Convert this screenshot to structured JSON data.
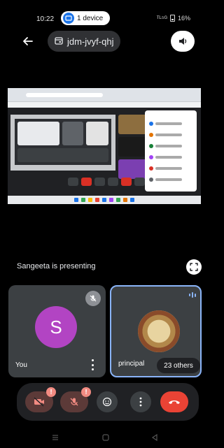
{
  "status_bar": {
    "time": "10:22",
    "device_label": "1 device",
    "signal_text": "ᵀᴸ⁵ᴳ",
    "battery": "16%"
  },
  "meeting": {
    "code": "jdm-jvyf-qhj"
  },
  "presentation": {
    "presenting_text": "Sangeeta is presenting"
  },
  "participants": {
    "you_initial": "S",
    "you_name": "You",
    "other_name": "principal",
    "others_count": "23 others"
  },
  "controls": {
    "camera_alert": "!",
    "mic_alert": "!"
  },
  "colors": {
    "background": "#000000",
    "tile": "#3c4043",
    "avatar": "#b244c3",
    "end_call": "#ea4335",
    "active_speaker": "#8ab4f8",
    "disabled_control": "#5c3a38"
  },
  "icons": [
    "back-arrow-icon",
    "calendar-icon",
    "speaker-icon",
    "fullscreen-icon",
    "mic-off-icon",
    "speaking-icon",
    "camera-off-icon",
    "emoji-icon",
    "more-vert-icon",
    "call-end-icon",
    "nav-menu-icon",
    "nav-home-icon",
    "nav-back-icon"
  ]
}
